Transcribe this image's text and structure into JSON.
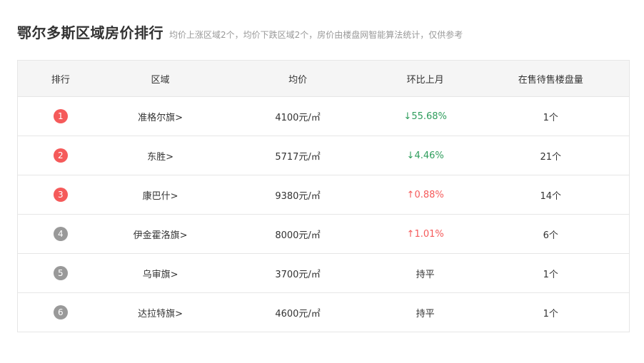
{
  "header": {
    "title": "鄂尔多斯区域房价排行",
    "subtitle": "均价上涨区域2个，均价下跌区域2个，房价由楼盘网智能算法统计，仅供参考"
  },
  "colors": {
    "rank_top": "#f55a5a",
    "rank_other": "#999999",
    "down": "#2e9d5c",
    "up": "#f55a5a"
  },
  "table": {
    "columns": [
      "排行",
      "区域",
      "均价",
      "环比上月",
      "在售待售楼盘量"
    ],
    "rows": [
      {
        "rank": "1",
        "area": "准格尔旗>",
        "price": "4100元/㎡",
        "change": "↓55.68%",
        "trend": "down",
        "count": "1个"
      },
      {
        "rank": "2",
        "area": "东胜>",
        "price": "5717元/㎡",
        "change": "↓4.46%",
        "trend": "down",
        "count": "21个"
      },
      {
        "rank": "3",
        "area": "康巴什>",
        "price": "9380元/㎡",
        "change": "↑0.88%",
        "trend": "up",
        "count": "14个"
      },
      {
        "rank": "4",
        "area": "伊金霍洛旗>",
        "price": "8000元/㎡",
        "change": "↑1.01%",
        "trend": "up",
        "count": "6个"
      },
      {
        "rank": "5",
        "area": "乌审旗>",
        "price": "3700元/㎡",
        "change": "持平",
        "trend": "flat",
        "count": "1个"
      },
      {
        "rank": "6",
        "area": "达拉特旗>",
        "price": "4600元/㎡",
        "change": "持平",
        "trend": "flat",
        "count": "1个"
      }
    ]
  }
}
